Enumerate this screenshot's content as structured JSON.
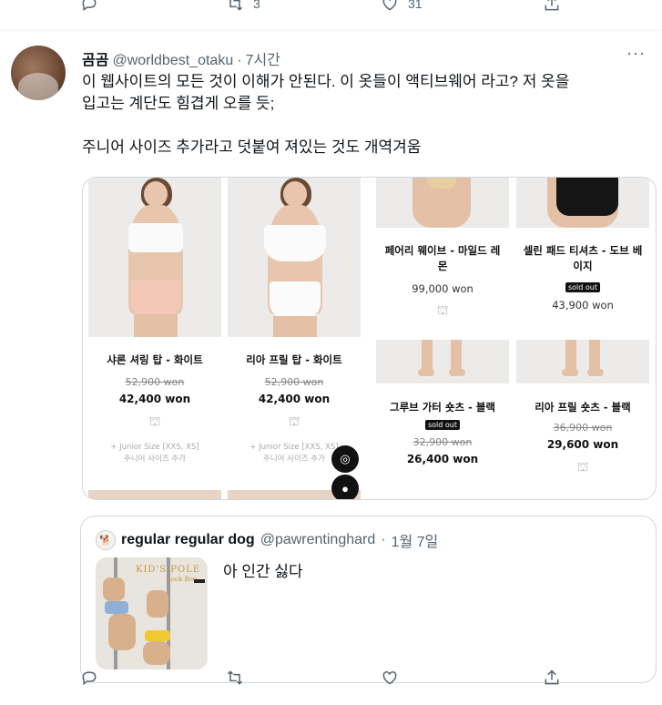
{
  "top_actions": {
    "reply_count": "",
    "retweet_count": "3",
    "like_count": "31"
  },
  "tweet": {
    "author_name": "곰곰",
    "handle": "@worldbest_otaku",
    "separator": "·",
    "time": "7시간",
    "more": "···",
    "text_line1": "이 웹사이트의 모든 것이 이해가 안된다. 이 옷들이 액티브웨어 라고? 저 옷을",
    "text_line2": "입고는 계단도 힘겹게 오를 듯;",
    "text_line3": "주니어 사이즈 추가라고 덧붙여 져있는 것도 개역겨움"
  },
  "products": [
    {
      "title": "샤론 셔링 탑 - 화이트",
      "old_price": "52,900 won",
      "price": "42,400 won",
      "junior1": "+ Junior Size [XXS, XS]",
      "junior2": "주니어 사이즈 추가"
    },
    {
      "title": "리아 프릴 탑 - 화이트",
      "old_price": "52,900 won",
      "price": "42,400 won",
      "junior1": "+ Junior Size [XXS, XS]",
      "junior2": "주니어 사이즈 추가"
    },
    {
      "title_l1": "페어리 웨이브 - 마일드 레",
      "title_l2": "몬",
      "price": "99,000 won"
    },
    {
      "title_l1": "셀린 패드 티셔츠 - 도브 베",
      "title_l2": "이지",
      "sold_out": "sold out",
      "price": "43,900 won"
    },
    {
      "title": "그루브 가터 숏츠 - 블랙",
      "sold_out": "sold out",
      "old_price": "32,900 won",
      "price": "26,400 won"
    },
    {
      "title": "리아 프릴 숏츠 - 블랙",
      "old_price": "36,900 won",
      "price": "29,600 won"
    }
  ],
  "quote": {
    "author_name": "regular regular dog",
    "handle": "@pawrentinghard",
    "separator": "·",
    "time": "1월 7일",
    "text": "아 인간 싫다",
    "thumb_title": "KID'S POLE",
    "thumb_sub": "Look Boo"
  },
  "bottom_actions": {
    "reply_count": "",
    "retweet_count": "",
    "like_count": ""
  },
  "colors": {
    "text": "#0f1419",
    "muted": "#536471",
    "border": "#cfd9de"
  }
}
